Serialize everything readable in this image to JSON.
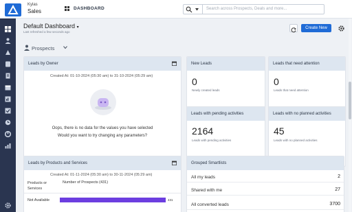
{
  "app": {
    "brand_top": "Kylas",
    "brand_bottom": "Sales",
    "page": "DASHBOARD"
  },
  "search": {
    "placeholder": "Search across Prospects, Deals and more..."
  },
  "header": {
    "title": "Default Dashboard",
    "subtitle": "Last refreshed a few seconds ago",
    "create_label": "Create New"
  },
  "filter": {
    "label": "Prospects"
  },
  "cards": {
    "leads_by_owner": {
      "title": "Leads by Owner",
      "created": "Created At: 01-10-2024 (05:30 am) to 31-10-2024 (05:29 am)",
      "empty_line1": "Oops, there is no data for the values you have selected",
      "empty_line2": "Would you want to try changing any parameters?"
    },
    "new_leads": {
      "title": "New Leads",
      "value": "0",
      "caption": "Newly created leads"
    },
    "need_attention": {
      "title": "Leads that need attention",
      "value": "0",
      "caption": "Leads that need attention"
    },
    "pending": {
      "title": "Leads with pending activities",
      "value": "2164",
      "caption": "Leads with pending activities"
    },
    "no_planned": {
      "title": "Leads with no planned activities",
      "value": "45",
      "caption": "Leads with no planned activities"
    },
    "products": {
      "title": "Leads by Products and Services",
      "created": "Created At: 01-11-2024 (05:30 am) to 30-11-2024 (05:29 am)",
      "col1_line1": "Products or",
      "col1_line2": "Services",
      "col2": "Number of Prospects (431)",
      "row_label": "Not Available",
      "row_value": "431",
      "bar_fraction": 1.0
    },
    "smartlists": {
      "title": "Grouped Smartlists",
      "rows": [
        {
          "label": "All my leads",
          "value": "2"
        },
        {
          "label": "Shared with me",
          "value": "27"
        },
        {
          "label": "All converted leads",
          "value": "3700"
        }
      ]
    }
  },
  "colors": {
    "accent": "#1f6bd6",
    "sidebar": "#2a3550",
    "bar": "#6c3ee0",
    "card_header": "#dde6f0"
  }
}
